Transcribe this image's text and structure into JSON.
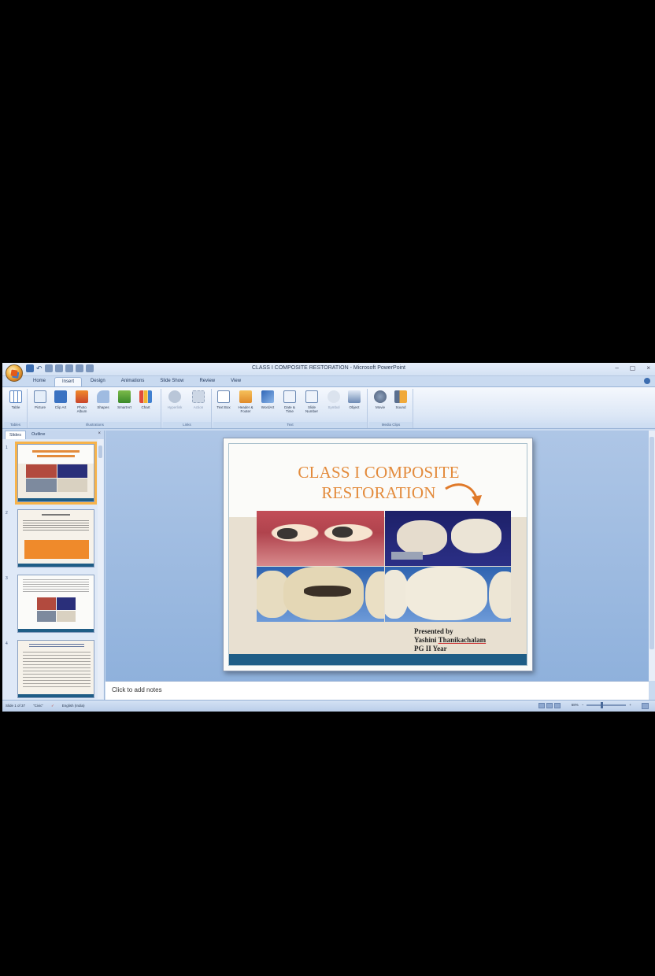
{
  "window": {
    "title": "CLASS I COMPOSITE RESTORATION - Microsoft PowerPoint",
    "controls": [
      "–",
      "▢",
      "×"
    ]
  },
  "ribbon": {
    "tabs": [
      "Home",
      "Insert",
      "Design",
      "Animations",
      "Slide Show",
      "Review",
      "View"
    ],
    "active_tab": "Insert",
    "groups": [
      {
        "label": "Tables",
        "buttons": [
          "Table"
        ]
      },
      {
        "label": "Illustrations",
        "buttons": [
          "Picture",
          "Clip Art",
          "Photo Album",
          "Shapes",
          "SmartArt",
          "Chart"
        ]
      },
      {
        "label": "Links",
        "buttons": [
          "Hyperlink",
          "Action"
        ]
      },
      {
        "label": "Text",
        "buttons": [
          "Text Box",
          "Header & Footer",
          "WordArt",
          "Date & Time",
          "Slide Number",
          "Symbol",
          "Object"
        ]
      },
      {
        "label": "Media Clips",
        "buttons": [
          "Movie",
          "Sound"
        ]
      }
    ]
  },
  "sidepanel": {
    "tabs": [
      "Slides",
      "Outline"
    ],
    "active_tab": "Slides",
    "slide_numbers": [
      "1",
      "2",
      "3",
      "4"
    ]
  },
  "slide": {
    "title_line1": "CLASS I COMPOSITE",
    "title_line2": "RESTORATION",
    "presented_by": "Presented by",
    "presenter_first": "Yashini",
    "presenter_last": "Thanikachalam",
    "year": "PG II Year"
  },
  "notes": {
    "placeholder": "Click to add notes"
  },
  "statusbar": {
    "slide_info": "Slide 1 of 37",
    "theme": "\"Civic\"",
    "language": "English (India)",
    "zoom": "68%"
  },
  "colors": {
    "title_orange": "#e38b3c",
    "accent_bar": "#1f5d86",
    "ribbon_blue": "#dce7f6"
  }
}
